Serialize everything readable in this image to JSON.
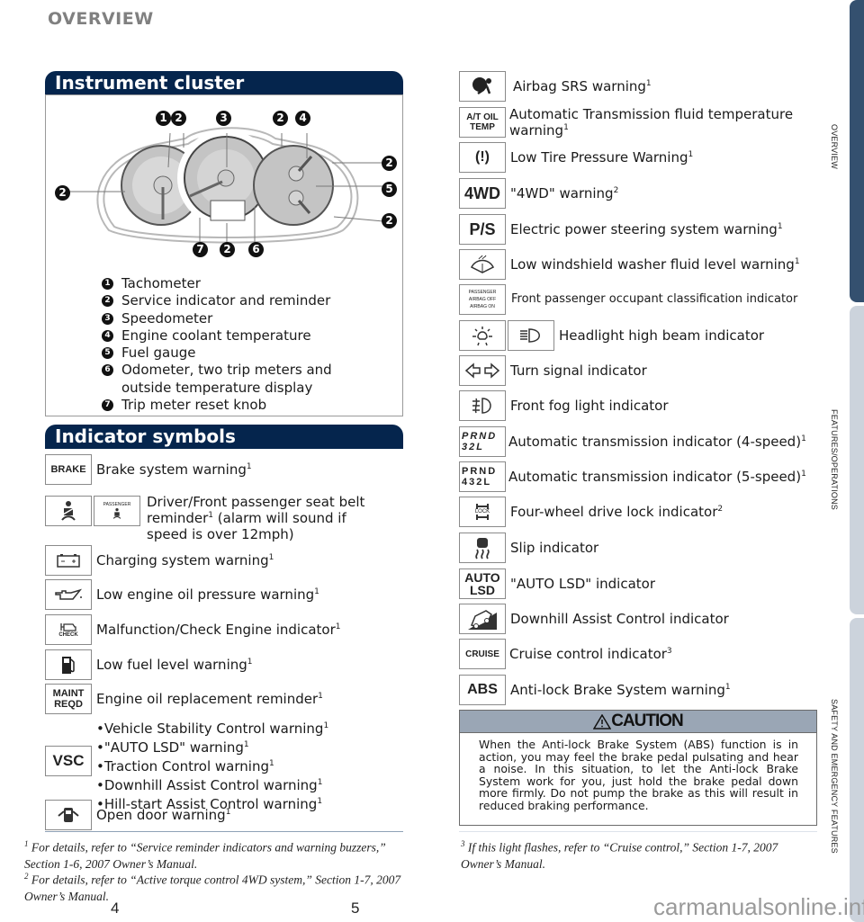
{
  "page": {
    "heading": "OVERVIEW",
    "page_left": "4",
    "page_right": "5",
    "watermark": "carmanualsonline.info"
  },
  "side_tabs": [
    {
      "label": "OVERVIEW",
      "active": true,
      "color": "#34506f"
    },
    {
      "label": "FEATURES/OPERATIONS",
      "active": false,
      "color": "#ccd3dc"
    },
    {
      "label": "SAFETY AND EMERGENCY FEATURES",
      "active": false,
      "color": "#ccd3dc"
    }
  ],
  "instrument_cluster": {
    "title": "Instrument cluster",
    "callout_numbers": [
      "1",
      "2",
      "3",
      "2",
      "4",
      "2",
      "5",
      "2",
      "2",
      "7",
      "2",
      "6"
    ],
    "legend": [
      {
        "num": "1",
        "text": "Tachometer"
      },
      {
        "num": "2",
        "text": "Service indicator and reminder"
      },
      {
        "num": "3",
        "text": "Speedometer"
      },
      {
        "num": "4",
        "text": "Engine coolant temperature"
      },
      {
        "num": "5",
        "text": "Fuel gauge"
      },
      {
        "num": "6",
        "text": "Odometer, two trip meters and outside temperature display"
      },
      {
        "num": "7",
        "text": "Trip meter reset knob"
      }
    ]
  },
  "indicator_symbols": {
    "title": "Indicator symbols",
    "left": [
      {
        "icon": "brake-text-icon",
        "icon_text": "BRAKE",
        "text": "Brake system warning",
        "note": "1"
      },
      {
        "icon": "seat-belt-icon",
        "icon_text": "PASSENGER",
        "text": "Driver/Front passenger seat belt reminder",
        "note": "1",
        "text_after": " (alarm will sound if speed is over 12mph)"
      },
      {
        "icon": "battery-icon",
        "text": "Charging system warning",
        "note": "1"
      },
      {
        "icon": "oil-can-icon",
        "text": "Low engine oil pressure warning",
        "note": "1"
      },
      {
        "icon": "check-engine-icon",
        "icon_text": "CHECK",
        "text": "Malfunction/Check Engine indicator",
        "note": "1"
      },
      {
        "icon": "fuel-pump-icon",
        "text": "Low fuel level warning",
        "note": "1"
      },
      {
        "icon": "maint-reqd-icon",
        "icon_text": "MAINT REQD",
        "text": "Engine oil replacement reminder",
        "note": "1"
      },
      {
        "icon": "vsc-icon",
        "icon_text": "VSC",
        "bullets": [
          {
            "text": "•Vehicle Stability Control warning",
            "note": "1"
          },
          {
            "text": "•\"AUTO LSD\" warning",
            "note": "1"
          },
          {
            "text": "•Traction Control warning",
            "note": "1"
          },
          {
            "text": "•Downhill Assist Control warning",
            "note": "1"
          },
          {
            "text": "•Hill-start Assist Control warning",
            "note": "1"
          }
        ]
      },
      {
        "icon": "open-door-icon",
        "text": "Open door warning",
        "note": "1"
      }
    ],
    "right": [
      {
        "icon": "airbag-icon",
        "text": "Airbag SRS warning",
        "note": "1"
      },
      {
        "icon": "at-oil-temp-icon",
        "icon_text": "A/T OIL TEMP",
        "text": "Automatic Transmission fluid temperature warning",
        "note": "1"
      },
      {
        "icon": "tire-pressure-icon",
        "text": "Low Tire Pressure Warning",
        "note": "1"
      },
      {
        "icon": "4wd-icon",
        "icon_text": "4WD",
        "text": "\"4WD\" warning",
        "note": "2"
      },
      {
        "icon": "power-steering-icon",
        "icon_text": "P/S",
        "text": "Electric power steering system warning",
        "note": "1"
      },
      {
        "icon": "washer-fluid-icon",
        "text": "Low windshield washer fluid level warning",
        "note": "1"
      },
      {
        "icon": "passenger-airbag-icon",
        "icon_text": "PASSENGER AIRBAG OFF AIRBAG ON",
        "text": "Front passenger occupant classification indicator"
      },
      {
        "icon": "high-beam-icon",
        "text": "Headlight high beam indicator"
      },
      {
        "icon": "turn-signal-icon",
        "text": "Turn signal indicator"
      },
      {
        "icon": "fog-light-icon",
        "text": "Front fog light indicator"
      },
      {
        "icon": "at-4speed-icon",
        "icon_text": "PRND 32L",
        "text": "Automatic transmission indicator (4-speed)",
        "note": "1"
      },
      {
        "icon": "at-5speed-icon",
        "icon_text": "PRND 432L",
        "text": "Automatic transmission indicator (5-speed)",
        "note": "1"
      },
      {
        "icon": "4wd-lock-icon",
        "icon_text": "LOCK",
        "text": "Four-wheel drive lock indicator",
        "note": "2"
      },
      {
        "icon": "slip-icon",
        "text": "Slip indicator"
      },
      {
        "icon": "auto-lsd-icon",
        "icon_text": "AUTO LSD",
        "text": "\"AUTO LSD\" indicator"
      },
      {
        "icon": "downhill-assist-icon",
        "text": "Downhill Assist Control indicator"
      },
      {
        "icon": "cruise-icon",
        "icon_text": "CRUISE",
        "text": "Cruise control indicator",
        "note": "3"
      },
      {
        "icon": "abs-icon",
        "icon_text": "ABS",
        "text": "Anti-lock Brake System warning",
        "note": "1"
      }
    ]
  },
  "caution": {
    "title": "CAUTION",
    "body": "When the Anti-lock Brake System (ABS) function is in action, you may feel the brake pedal pulsating and hear a noise. In this situation, to let the Anti-lock Brake System work for you, just hold the brake pedal down more firmly. Do not pump the brake as this will result in reduced braking performance."
  },
  "footnotes": [
    {
      "num": "1",
      "text": "For details, refer to “Service reminder indicators and warning buzzers,” Section 1-6, 2007 Owner’s Manual."
    },
    {
      "num": "2",
      "text": "For details, refer to “Active torque control 4WD system,” Section 1-7, 2007 Owner’s Manual."
    },
    {
      "num": "3",
      "text": "If this light flashes, refer to “Cruise control,” Section 1-7, 2007 Owner’s Manual."
    }
  ]
}
